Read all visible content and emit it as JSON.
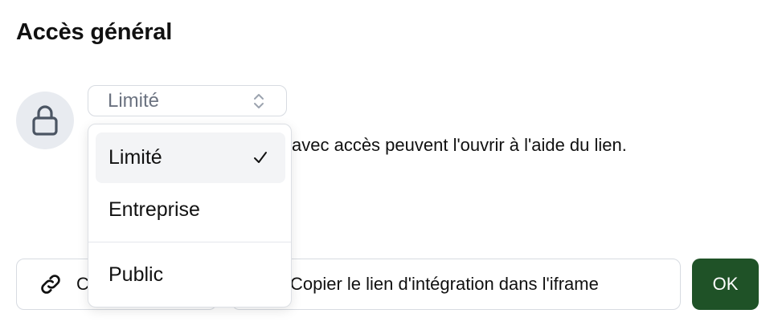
{
  "heading": "Accès général",
  "access": {
    "lock_icon": "lock-icon",
    "selected_value": "Limité",
    "description_visible": "avec accès peuvent l'ouvrir à l'aide du lien."
  },
  "dropdown": {
    "options": [
      {
        "label": "Limité",
        "selected": true
      },
      {
        "label": "Entreprise",
        "selected": false
      },
      {
        "label": "Public",
        "selected": false
      }
    ]
  },
  "footer": {
    "copy_link_visible": "C",
    "copy_embed_label": "Copier le lien d'intégration dans l'iframe",
    "ok_label": "OK"
  },
  "colors": {
    "primary_button": "#1f5227",
    "avatar_bg": "#e8ebf0",
    "selected_option_bg": "#f3f4f6",
    "border": "#d7dbe1"
  }
}
